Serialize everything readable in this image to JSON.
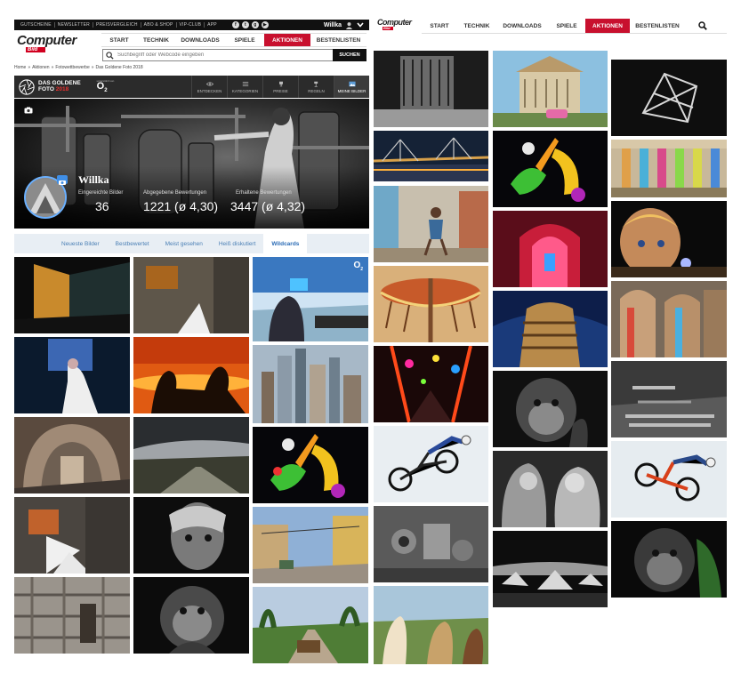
{
  "topbar": {
    "links": [
      "GUTSCHEINE",
      "NEWSLETTER",
      "PREISVERGLEICH",
      "ABO & SHOP",
      "VIP-CLUB",
      "APP"
    ],
    "social_icons": [
      "facebook-icon",
      "twitter-icon",
      "googleplus-icon",
      "youtube-icon"
    ],
    "user_name": "Willka"
  },
  "logo": {
    "line1": "Computer",
    "line2": "Bild"
  },
  "nav": {
    "items": [
      "START",
      "TECHNIK",
      "DOWNLOADS",
      "SPIELE",
      "AKTIONEN",
      "BESTENLISTEN"
    ],
    "active": "AKTIONEN"
  },
  "search": {
    "placeholder": "Suchbegriff oder Webcode eingeben",
    "button": "SUCHEN"
  },
  "breadcrumb": [
    "Home",
    "»",
    "Aktionen",
    "»",
    "Fotowettbewerbe",
    "»",
    "Das Goldene Foto 2018"
  ],
  "contest": {
    "title_line1": "DAS GOLDENE",
    "title_line2": "FOTO",
    "year": "2018",
    "sponsor_caption": "unterstützt von",
    "sponsor": "O",
    "sponsor_sub": "2",
    "tabs": [
      "ENTDECKEN",
      "KATEGORIEN",
      "PREISE",
      "REGELN",
      "MEINE BILDER"
    ],
    "active_tab": "MEINE BILDER"
  },
  "profile": {
    "name": "Willka",
    "stats": [
      {
        "label": "Eingereichte Bilder",
        "value": "36"
      },
      {
        "label": "Abgegebene Bewertungen",
        "value": "1221 (ø 4,30)"
      },
      {
        "label": "Erhaltene Bewertungen",
        "value": "3447 (ø 4,32)"
      }
    ]
  },
  "gallery_tabs": [
    "Neueste Bilder",
    "Bestbewertet",
    "Meist gesehen",
    "Heiß diskutiert",
    "Wildcards"
  ],
  "gallery_active": "Wildcards",
  "tile_badge": {
    "main": "O",
    "sub": "2"
  },
  "colors": {
    "accent": "#c8102e",
    "link": "#4a7fb5",
    "dark_bar": "#2b2b2b"
  }
}
